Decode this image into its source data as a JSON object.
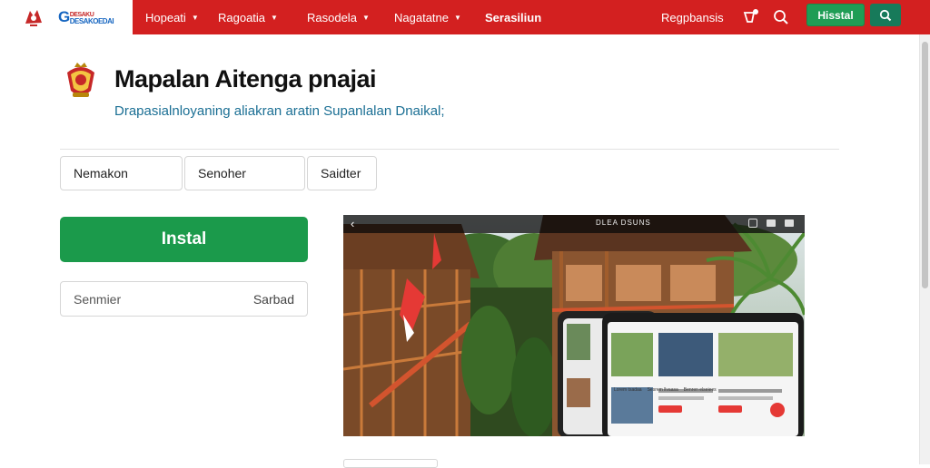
{
  "brand": {
    "logo_text": "G",
    "logo_sub_top": "DESAKU",
    "logo_sub_bottom": "DESAKOEDAI"
  },
  "nav": {
    "items": [
      {
        "label": "Hopeati",
        "has_caret": true
      },
      {
        "label": "Ragoatia",
        "has_caret": true
      },
      {
        "label": "Rasodela",
        "has_caret": true
      },
      {
        "label": "Nagatatne",
        "has_caret": true
      },
      {
        "label": "Serasiliun",
        "has_caret": false
      }
    ],
    "right_link": "Regpbansis",
    "install_label": "Hisstal",
    "icons": [
      "notification-icon",
      "search-icon"
    ]
  },
  "header": {
    "title": "Mapalan Aitenga pnajai",
    "subtitle": "Drapasialnloyaning aliakran aratin  Supanlalan  Dnaikal;"
  },
  "filters": [
    {
      "label": "Nemakon"
    },
    {
      "label": "Senoher"
    },
    {
      "label": "Saidter"
    }
  ],
  "install_button": "Instal",
  "search": {
    "placeholder": "Senmier",
    "button_label": "Sarbad"
  },
  "hero": {
    "top_title": "DLEA DSUNS",
    "cards": [
      {
        "label": "Lorem tsadaa"
      },
      {
        "label": "Sesrem llvaasa"
      },
      {
        "label": "Benren elseiees"
      }
    ]
  },
  "colors": {
    "nav_red": "#d32020",
    "install_green": "#1b9a4b",
    "subtitle_teal": "#1b6f94",
    "search_btn_green": "#177a5a"
  }
}
